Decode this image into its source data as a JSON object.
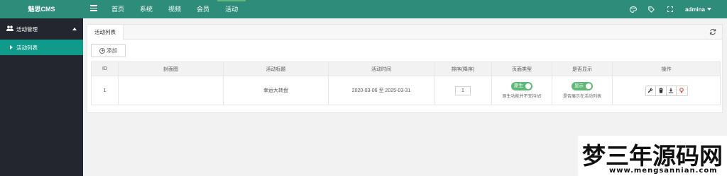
{
  "app": {
    "title": "魅思CMS"
  },
  "nav": {
    "items": [
      "首页",
      "系统",
      "视频",
      "会员",
      "活动"
    ],
    "active": "活动"
  },
  "header": {
    "user": "admina"
  },
  "sidebar": {
    "group": {
      "label": "活动管理"
    },
    "items": [
      {
        "label": "活动列表",
        "active": true
      }
    ]
  },
  "panel": {
    "tab": "活动列表",
    "add_label": "添加",
    "table": {
      "headers": [
        "ID",
        "封面图",
        "活动标题",
        "活动时间",
        "排序(降序)",
        "页面类型",
        "是否显示",
        "操作"
      ],
      "rows": [
        {
          "id": "1",
          "cover": "",
          "title": "幸运大转盘",
          "time": "2020-03-06 至 2025-03-31",
          "sort": "1",
          "page_type": {
            "switch": "原生",
            "note": "原生功能并不支持h5"
          },
          "display": {
            "switch": "显示",
            "note": "是否展示在活动列表"
          }
        }
      ]
    }
  },
  "watermark": {
    "big": "梦三年源码网",
    "small": "www.mengsannian.com"
  },
  "colors": {
    "header": "#2d8c7a",
    "sidebar": "#23262e",
    "active_item": "#0f9a8a",
    "switch": "#5fb878"
  },
  "icons": [
    "menu-icon",
    "palette-icon",
    "tag-icon",
    "fullscreen-icon",
    "dropdown-caret-icon",
    "group-icon",
    "play-icon",
    "refresh-icon",
    "plus-circle-icon",
    "wrench-icon",
    "trash-icon",
    "download-icon",
    "bulb-icon"
  ]
}
